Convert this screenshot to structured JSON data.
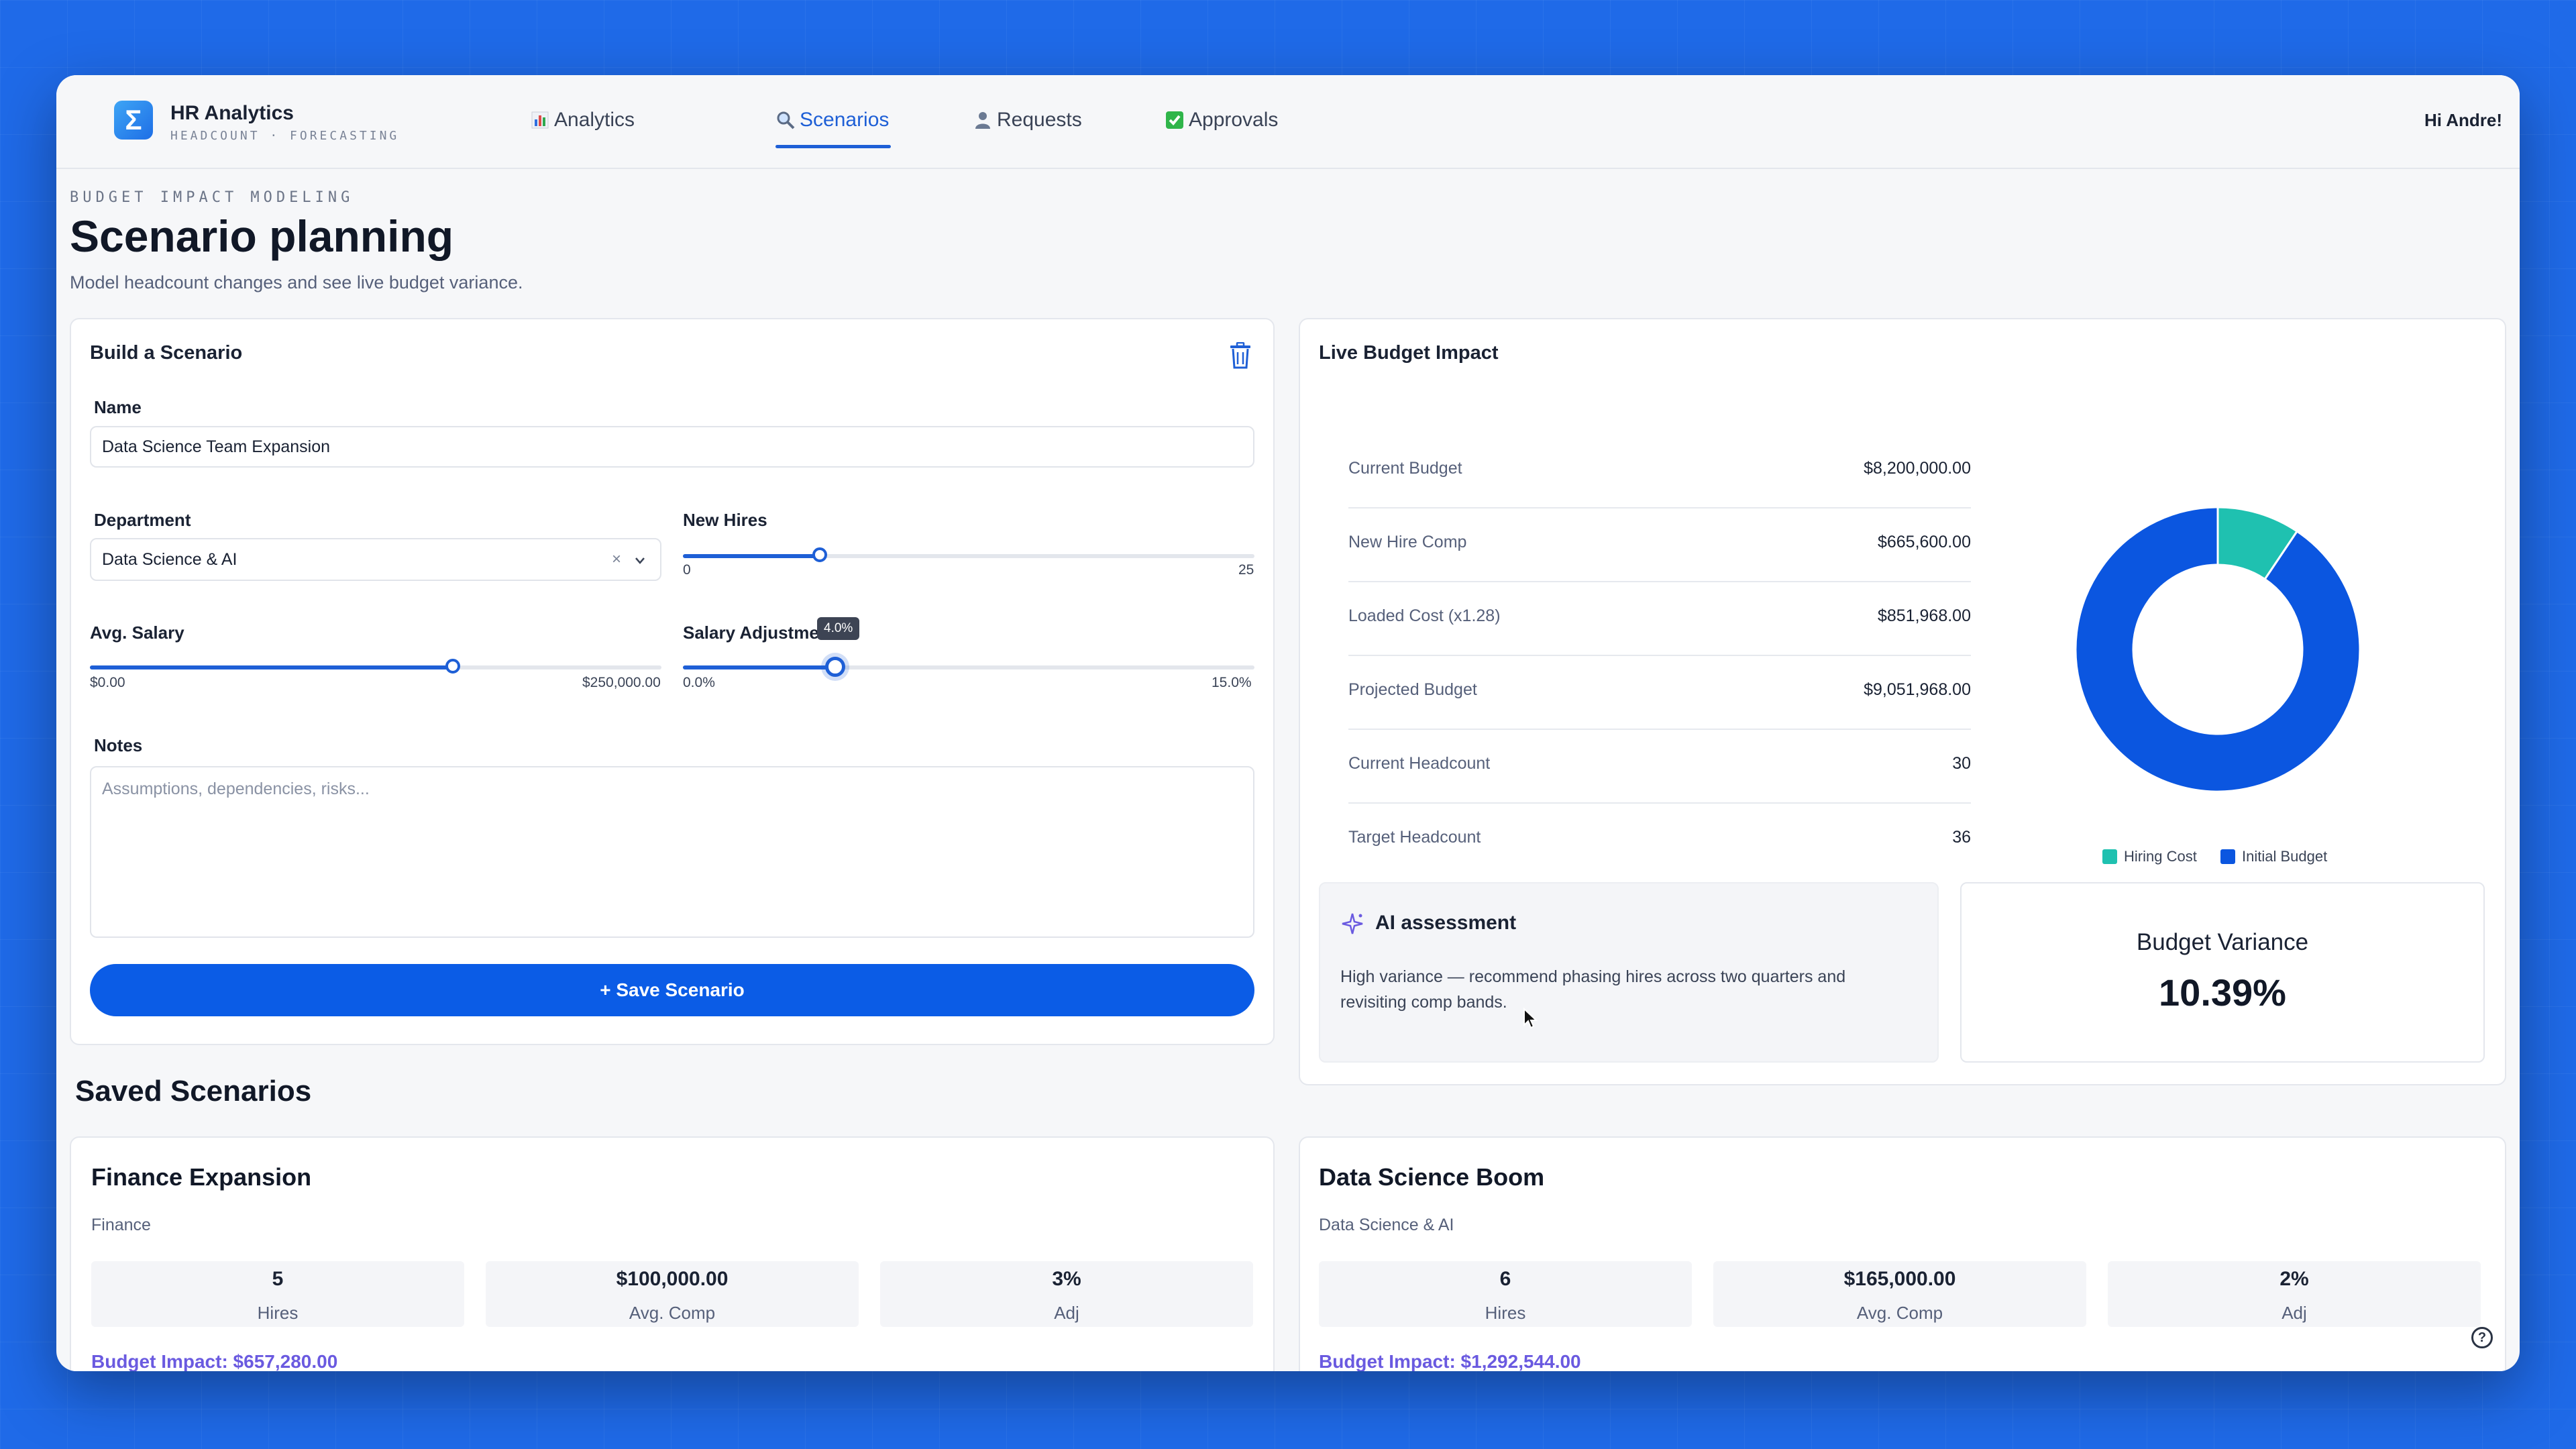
{
  "app": {
    "title": "HR Analytics",
    "subtitle": "HEADCOUNT · FORECASTING",
    "greeting": "Hi Andre!"
  },
  "nav": {
    "items": [
      {
        "label": "Analytics",
        "icon": "bar-chart-icon",
        "active": false
      },
      {
        "label": "Scenarios",
        "icon": "magnifier-icon",
        "active": true
      },
      {
        "label": "Requests",
        "icon": "person-icon",
        "active": false
      },
      {
        "label": "Approvals",
        "icon": "checkbox-icon",
        "active": false
      }
    ]
  },
  "header": {
    "eyebrow": "BUDGET IMPACT MODELING",
    "title": "Scenario planning",
    "subtitle": "Model headcount changes and see live budget variance."
  },
  "builder": {
    "title": "Build a Scenario",
    "name_label": "Name",
    "name_value": "Data Science Team Expansion",
    "department_label": "Department",
    "department_value": "Data Science & AI",
    "new_hires_label": "New Hires",
    "new_hires_min": "0",
    "new_hires_max": "25",
    "new_hires_value": 6,
    "avg_salary_label": "Avg. Salary",
    "avg_salary_min": "$0.00",
    "avg_salary_max": "$250,000.00",
    "avg_salary_fraction": 0.635,
    "salary_adj_label": "Salary Adjustment",
    "salary_adj_min": "0.0%",
    "salary_adj_max": "15.0%",
    "salary_adj_tooltip": "4.0%",
    "salary_adj_value": 4.0,
    "notes_label": "Notes",
    "notes_placeholder": "Assumptions, dependencies, risks...",
    "save_label": "+ Save Scenario"
  },
  "impact": {
    "title": "Live Budget Impact",
    "rows": [
      {
        "label": "Current Budget",
        "value": "$8,200,000.00"
      },
      {
        "label": "New Hire Comp",
        "value": "$665,600.00"
      },
      {
        "label": "Loaded Cost (x1.28)",
        "value": "$851,968.00"
      },
      {
        "label": "Projected Budget",
        "value": "$9,051,968.00"
      },
      {
        "label": "Current Headcount",
        "value": "30"
      },
      {
        "label": "Target Headcount",
        "value": "36"
      }
    ],
    "ai_title": "AI assessment",
    "ai_text": "High variance — recommend phasing hires across two quarters and revisiting comp bands.",
    "variance_label": "Budget Variance",
    "variance_value": "10.39%"
  },
  "chart_data": {
    "type": "pie",
    "donut": true,
    "categories": [
      "Hiring Cost",
      "Initial Budget"
    ],
    "values": [
      851968,
      8200000
    ],
    "colors": [
      "#1fc1b0",
      "#0b56e0"
    ],
    "legend_position": "bottom"
  },
  "saved": {
    "title": "Saved Scenarios",
    "items": [
      {
        "name": "Finance Expansion",
        "department": "Finance",
        "hires": "5",
        "hires_label": "Hires",
        "comp": "$100,000.00",
        "comp_label": "Avg. Comp",
        "adj": "3%",
        "adj_label": "Adj",
        "impact": "Budget Impact: $657,280.00"
      },
      {
        "name": "Data Science Boom",
        "department": "Data Science & AI",
        "hires": "6",
        "hires_label": "Hires",
        "comp": "$165,000.00",
        "comp_label": "Avg. Comp",
        "adj": "2%",
        "adj_label": "Adj",
        "impact": "Budget Impact: $1,292,544.00"
      }
    ]
  },
  "colors": {
    "accent": "#1e5fd6",
    "button": "#0b5ce6",
    "impact_text": "#6a5ae0",
    "background": "#1f6ae8"
  }
}
